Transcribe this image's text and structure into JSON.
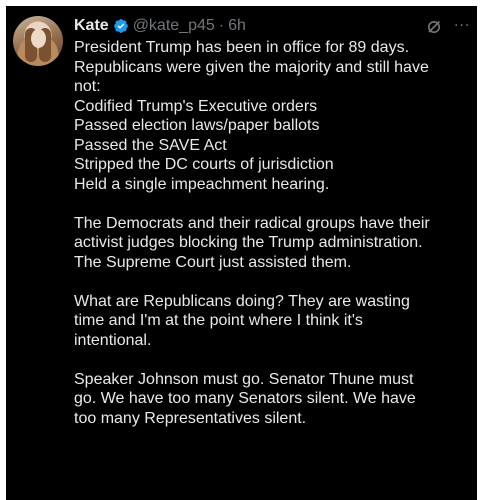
{
  "post": {
    "author_name": "Kate",
    "handle": "@kate_p45",
    "separator": "·",
    "time": "6h",
    "more_glyph": "···",
    "paragraphs": [
      [
        "President Trump has been in office for 89 days.",
        "Republicans were given the majority and still have",
        "not:",
        "Codified Trump's Executive orders",
        "Passed election laws/paper ballots",
        "Passed the SAVE Act",
        "Stripped the DC courts of jurisdiction",
        "Held a single impeachment hearing."
      ],
      [
        "The Democrats and their radical groups have their",
        "activist judges blocking the Trump administration.",
        "The Supreme Court just assisted them."
      ],
      [
        "What are Republicans doing? They are wasting",
        "time and I'm at the point where I think it's",
        "intentional."
      ],
      [
        "Speaker Johnson must go. Senator Thune must",
        "go. We have too many Senators silent. We have",
        "too many Representatives silent."
      ]
    ]
  },
  "icons": {
    "verified": "verified-badge-icon",
    "grok": "grok-icon",
    "more": "more-icon",
    "avatar": "profile-photo"
  },
  "colors": {
    "background": "#000000",
    "text_primary": "#e7e9ea",
    "text_secondary": "#71767b",
    "verified_blue": "#1d9bf0"
  }
}
